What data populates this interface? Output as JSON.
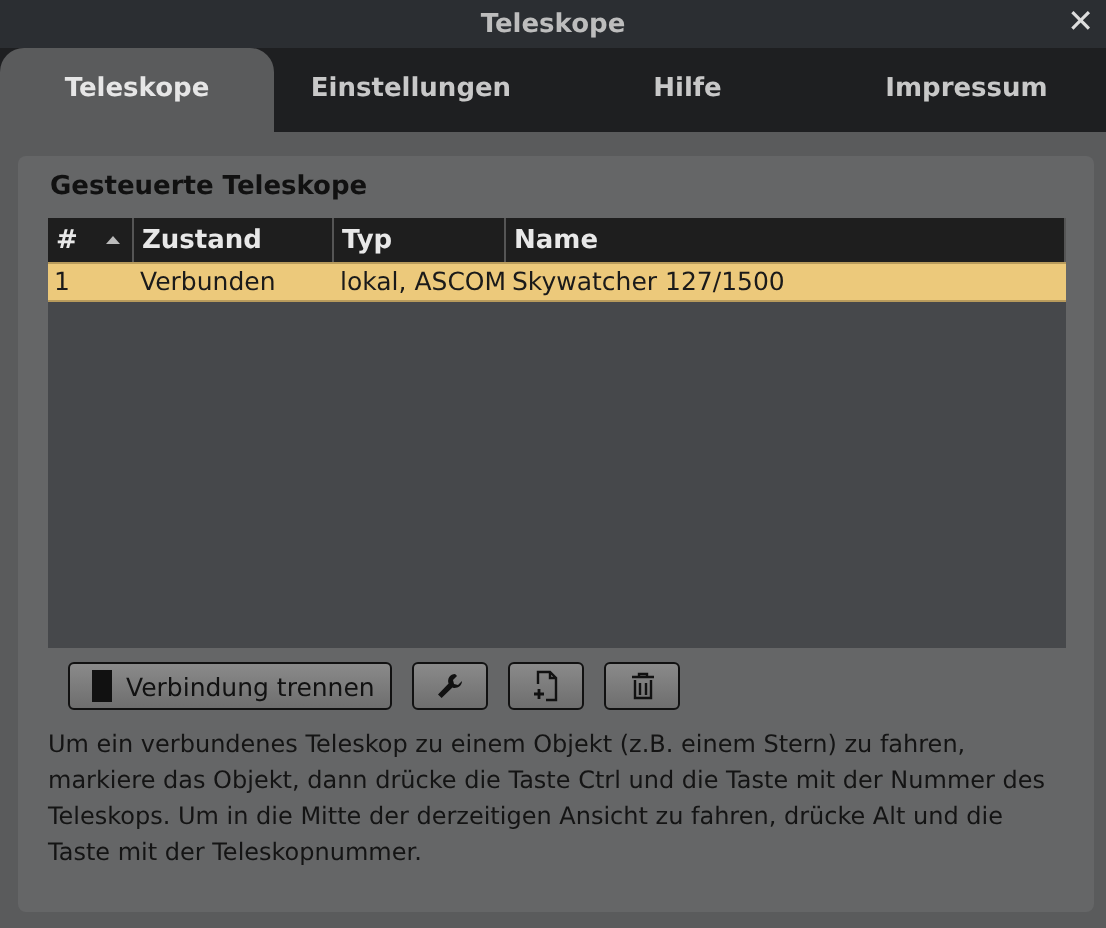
{
  "window": {
    "title": "Teleskope",
    "close": "✕"
  },
  "tabs": [
    {
      "label": "Teleskope",
      "selected": true
    },
    {
      "label": "Einstellungen",
      "selected": false
    },
    {
      "label": "Hilfe",
      "selected": false
    },
    {
      "label": "Impressum",
      "selected": false
    }
  ],
  "group": {
    "title": "Gesteuerte Teleskope"
  },
  "table": {
    "columns": [
      {
        "label": "#",
        "sorted": true
      },
      {
        "label": "Zustand",
        "sorted": false
      },
      {
        "label": "Typ",
        "sorted": false
      },
      {
        "label": "Name",
        "sorted": false
      }
    ],
    "rows": [
      {
        "cells": [
          "1",
          "Verbunden",
          "lokal, ASCOM",
          "Skywatcher 127/1500"
        ],
        "selected": true
      }
    ]
  },
  "buttons": [
    {
      "kind": "disconnect",
      "label": "Verbindung trennen"
    },
    {
      "kind": "configure"
    },
    {
      "kind": "add"
    },
    {
      "kind": "delete"
    }
  ],
  "description": "Um ein verbundenes Teleskop zu einem Objekt (z.B. einem Stern) zu fahren, markiere das Objekt, dann drücke die Taste Ctrl und die Taste mit der Nummer des Teleskops. Um in die Mitte der derzeitigen Ansicht zu fahren, drücke Alt und die Taste mit der Teleskopnummer."
}
